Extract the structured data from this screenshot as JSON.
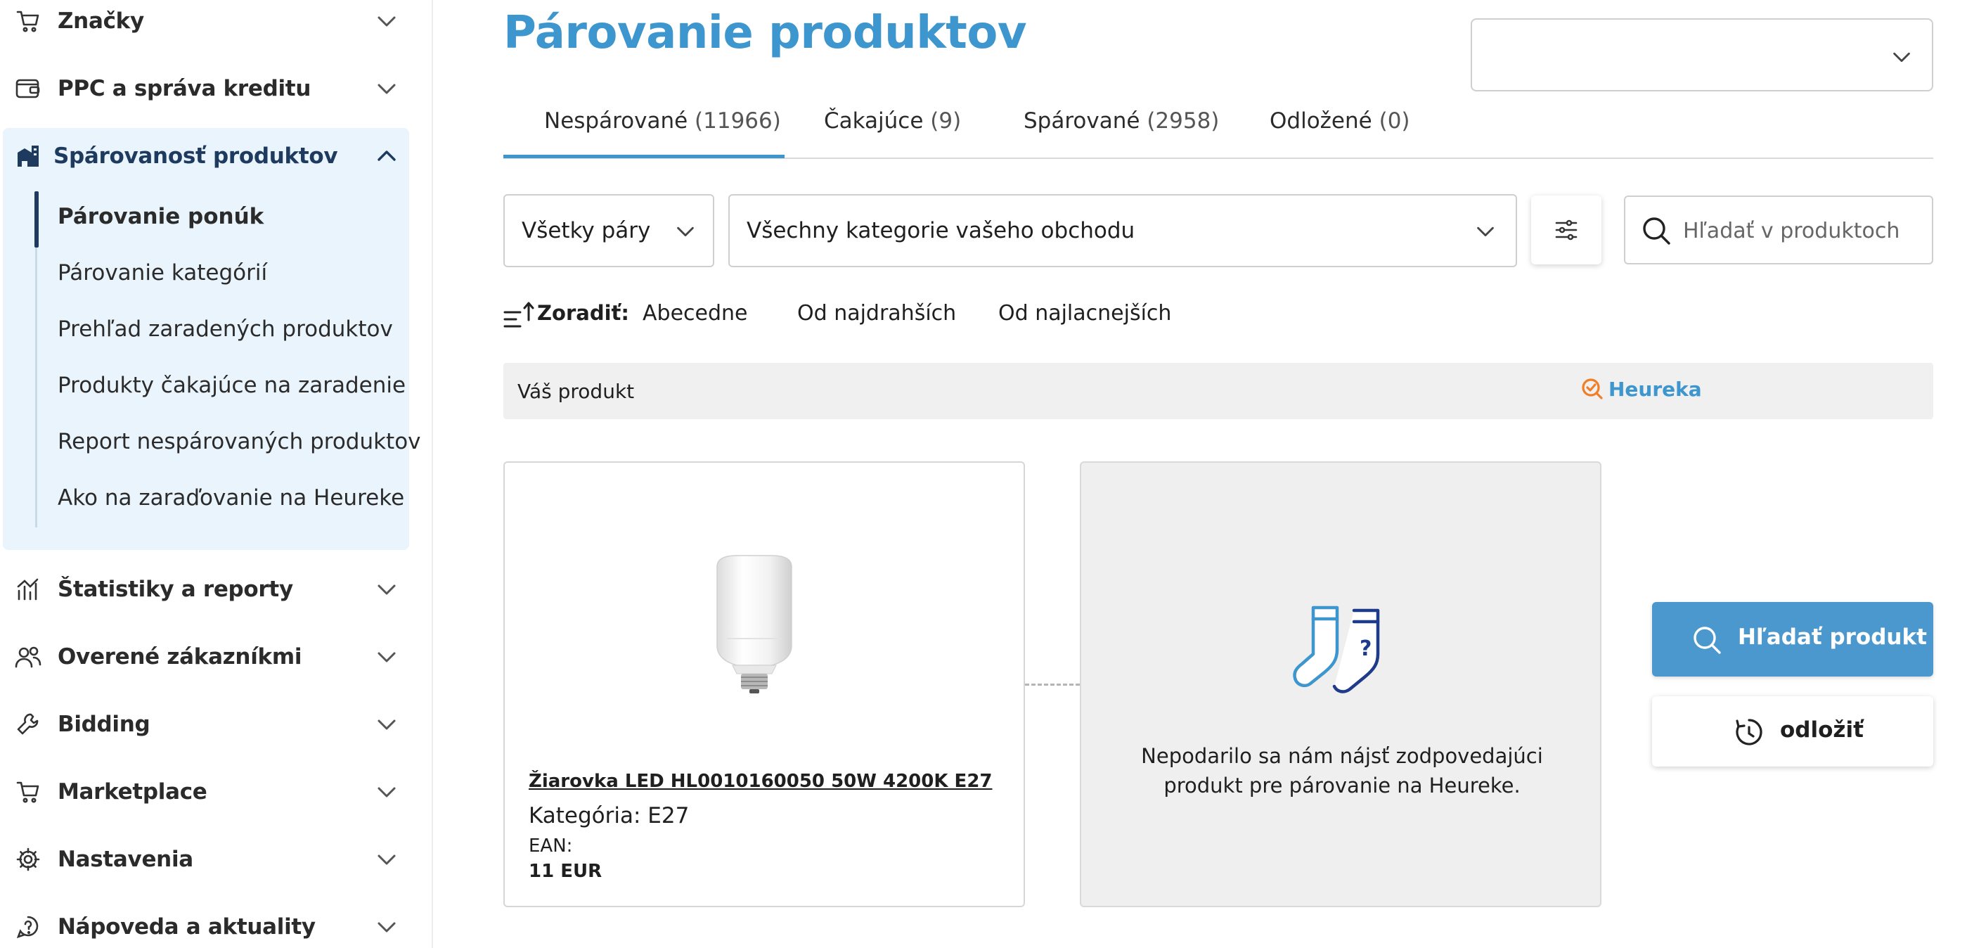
{
  "sidebar": {
    "items": [
      {
        "label": "Značky",
        "icon": "cart-icon"
      },
      {
        "label": "PPC a správa kreditu",
        "icon": "wallet-icon"
      },
      {
        "label": "Spárovanosť produktov",
        "icon": "buildings-icon"
      },
      {
        "label": "Štatistiky a reporty",
        "icon": "chart-icon"
      },
      {
        "label": "Overené zákazníkmi",
        "icon": "users-icon"
      },
      {
        "label": "Bidding",
        "icon": "wrench-icon"
      },
      {
        "label": "Marketplace",
        "icon": "cart-icon"
      },
      {
        "label": "Nastavenia",
        "icon": "gear-icon"
      },
      {
        "label": "Nápoveda a aktuality",
        "icon": "help-icon"
      }
    ],
    "subitems": [
      {
        "label": "Párovanie ponúk",
        "active": true
      },
      {
        "label": "Párovanie kategórií"
      },
      {
        "label": "Prehľad zaradených produktov"
      },
      {
        "label": "Produkty čakajúce na zaradenie"
      },
      {
        "label": "Report nespárovaných produktov"
      },
      {
        "label": "Ako na zaraďovanie na Heureke"
      }
    ]
  },
  "page": {
    "title": "Párovanie produktov"
  },
  "top_select": {
    "value": ""
  },
  "tabs": [
    {
      "label": "Nespárované",
      "count": "(11966)",
      "active": true
    },
    {
      "label": "Čakajúce",
      "count": "(9)"
    },
    {
      "label": "Spárované",
      "count": "(2958)"
    },
    {
      "label": "Odložené",
      "count": "(0)"
    }
  ],
  "filters": {
    "pairs": "Všetky páry",
    "categories": "Všechny kategorie vašeho obchodu",
    "search_placeholder": "Hľadať v produktoch"
  },
  "sort": {
    "label": "Zoradiť:",
    "options": [
      "Abecedne",
      "Od najdrahších",
      "Od najlacnejších"
    ]
  },
  "table_header": {
    "left": "Váš produkt",
    "right": "Heureka"
  },
  "product": {
    "name": "Žiarovka LED HL0010160050 50W 4200K E27",
    "category": "Kategória: E27",
    "ean": "EAN:",
    "price": "11 EUR"
  },
  "nomatch": {
    "text": "Nepodarilo sa nám nájsť zodpovedajúci produkt pre párovanie na Heureke."
  },
  "actions": {
    "search": "Hľadať produkt",
    "postpone": "odložiť"
  },
  "colors": {
    "accent": "#3d96cd",
    "button": "#4a98cd",
    "sidebar_active_bg": "#e9f4fc",
    "heureka_orange": "#f07e26"
  }
}
